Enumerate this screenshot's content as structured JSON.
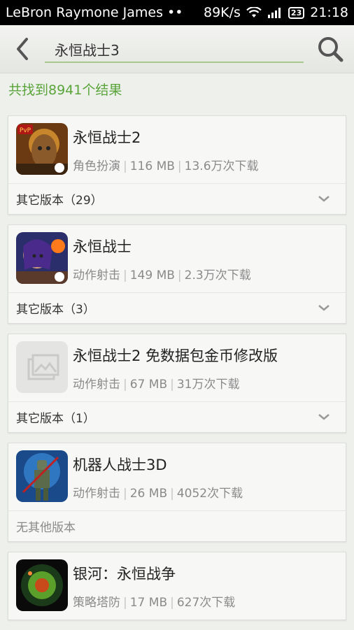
{
  "status_bar": {
    "carrier": "LeBron Raymone James",
    "dots": "••",
    "speed": "89K/s",
    "battery": "23",
    "time": "21:18"
  },
  "search": {
    "query": "永恒战士3"
  },
  "result_count": "共找到8941个结果",
  "results": [
    {
      "name": "永恒战士2",
      "category": "角色扮演",
      "size": "116 MB",
      "downloads": "13.6万次下载",
      "versions_label": "其它版本（29）",
      "icon": "eternity-warriors-2-icon"
    },
    {
      "name": "永恒战士",
      "category": "动作射击",
      "size": "149 MB",
      "downloads": "2.3万次下载",
      "versions_label": "其它版本（3）",
      "icon": "eternity-warriors-icon"
    },
    {
      "name": "永恒战士2 免数据包金币修改版",
      "category": "动作射击",
      "size": "67 MB",
      "downloads": "31万次下载",
      "versions_label": "其它版本（1）",
      "icon": "image-placeholder-icon"
    },
    {
      "name": "机器人战士3D",
      "category": "动作射击",
      "size": "26 MB",
      "downloads": "4052次下载",
      "versions_label": "无其他版本",
      "icon": "robot-warrior-3d-icon"
    },
    {
      "name": "银河：永恒战争",
      "category": "策略塔防",
      "size": "17 MB",
      "downloads": "627次下载",
      "icon": "galaxy-eternal-war-icon"
    }
  ],
  "colors": {
    "accent_green": "#5aa43a",
    "background": "#eef0ec"
  }
}
